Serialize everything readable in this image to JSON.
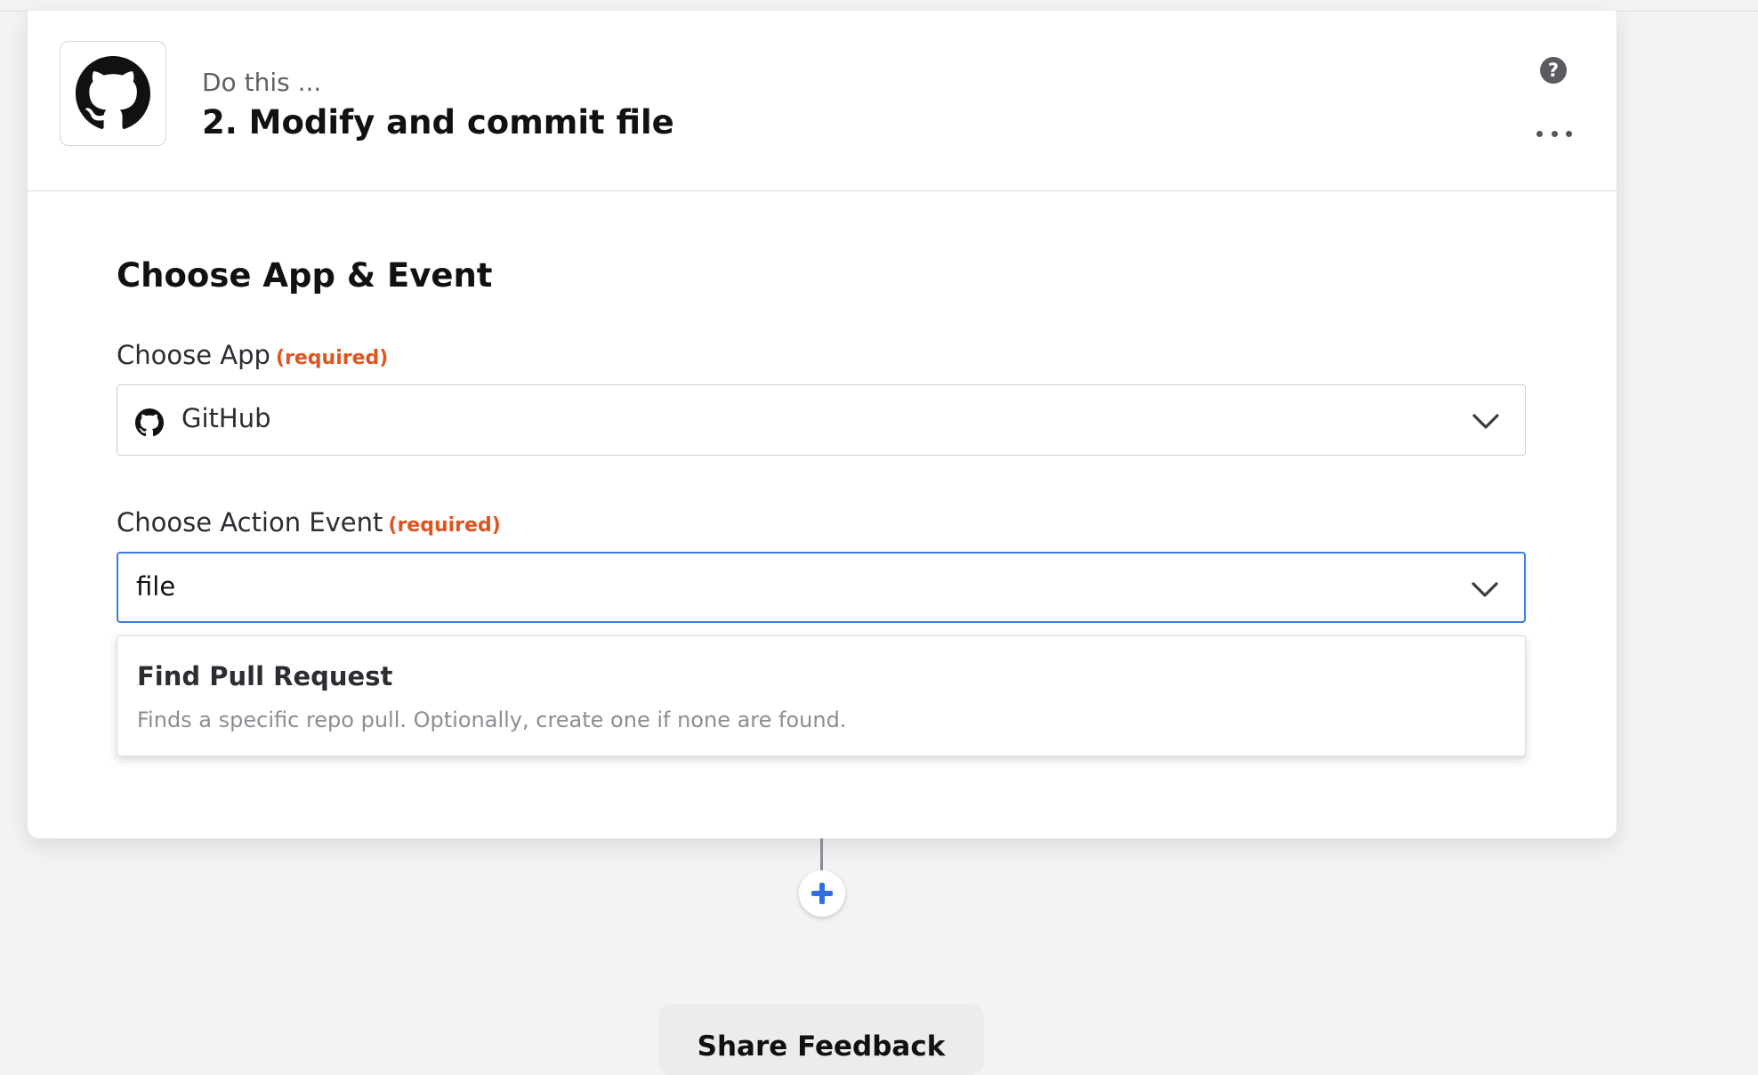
{
  "step": {
    "subtitle": "Do this ...",
    "title": "2. Modify and commit file",
    "app_icon": "github-icon"
  },
  "header_actions": {
    "help_icon": "question-icon",
    "help_glyph": "?",
    "more_icon": "ellipsis-icon"
  },
  "section": {
    "title": "Choose App & Event"
  },
  "choose_app": {
    "label": "Choose App",
    "required": "(required)",
    "value": "GitHub",
    "icon": "github-icon"
  },
  "choose_event": {
    "label": "Choose Action Event",
    "required": "(required)",
    "input_value": "file"
  },
  "dropdown": {
    "options": [
      {
        "title": "Find Pull Request",
        "description": "Finds a specific repo pull. Optionally, create one if none are found."
      }
    ]
  },
  "add_step": {
    "icon": "plus-icon"
  },
  "feedback": {
    "label": "Share Feedback"
  },
  "colors": {
    "required": "#e0541f",
    "focus_border": "#3b7dd8",
    "plus": "#2f6fe0"
  }
}
